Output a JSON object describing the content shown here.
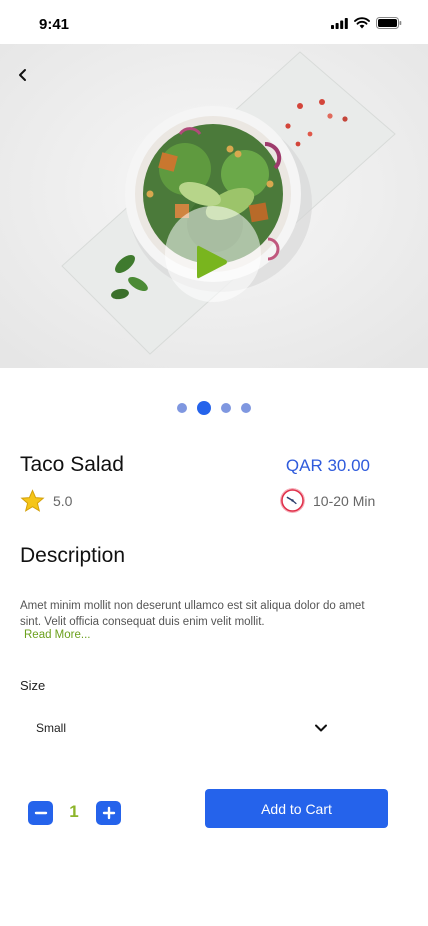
{
  "status_bar": {
    "time": "9:41",
    "icons": [
      "signal-icon",
      "wifi-icon",
      "battery-icon"
    ]
  },
  "hero": {
    "back_icon": "chevron-left-icon",
    "play_icon": "play-icon",
    "image": "taco-salad-bowl-photo"
  },
  "carousel": {
    "count": 4,
    "active_index": 1,
    "accent_color": "#2563EB",
    "inactive_color": "#7F97E0"
  },
  "product": {
    "title": "Taco Salad",
    "price": "QAR 30.00",
    "rating": "5.0",
    "rating_icon": "star-icon",
    "time": "10-20 Min",
    "time_icon": "clock-icon"
  },
  "description": {
    "heading": "Description",
    "text": "Amet minim mollit non deserunt ullamco est sit aliqua dolor do amet sint. Velit officia consequat duis enim velit mollit.",
    "read_more": "Read More..."
  },
  "size": {
    "label": "Size",
    "selected": "Small",
    "dropdown_icon": "chevron-down-icon"
  },
  "quantity": {
    "value": "1",
    "minus_icon": "minus-icon",
    "plus_icon": "plus-icon",
    "value_color": "#8DB52A"
  },
  "cart": {
    "button_label": "Add to Cart",
    "button_color": "#2563EB"
  }
}
